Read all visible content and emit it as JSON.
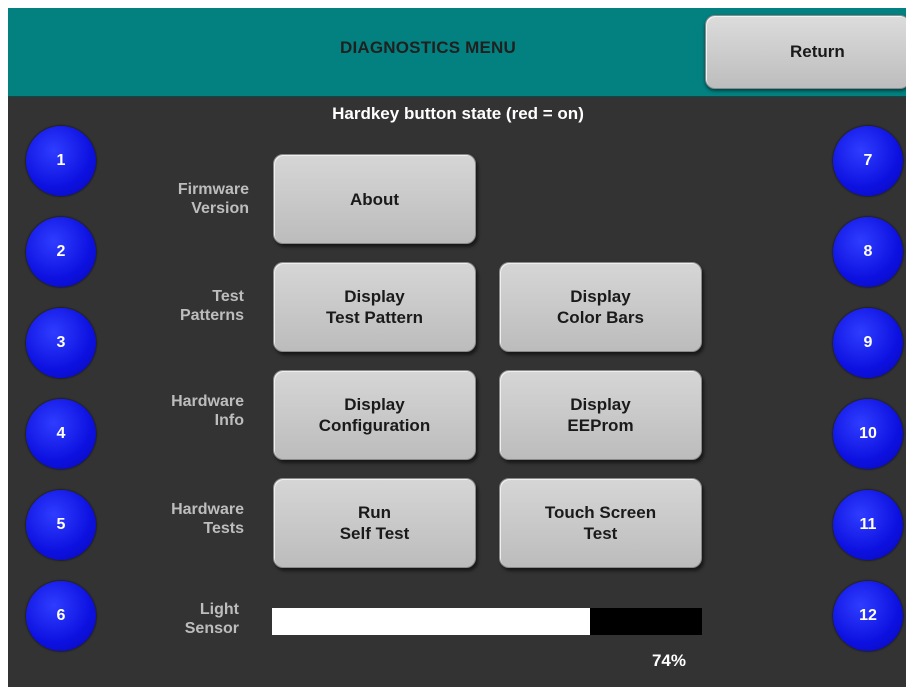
{
  "header": {
    "title": "DIAGNOSTICS MENU",
    "return_label": "Return"
  },
  "subtitle": "Hardkey button state (red = on)",
  "hardkeys": {
    "left": [
      "1",
      "2",
      "3",
      "4",
      "5",
      "6"
    ],
    "right": [
      "7",
      "8",
      "9",
      "10",
      "11",
      "12"
    ],
    "off_color": "#0D11E0",
    "on_color": "#FF0000"
  },
  "rows": {
    "firmware": {
      "label": "Firmware\nVersion",
      "about": "About"
    },
    "test_patterns": {
      "label": "Test\nPatterns",
      "pattern": "Display\nTest Pattern",
      "color_bars": "Display\nColor Bars"
    },
    "hardware_info": {
      "label": "Hardware\nInfo",
      "configuration": "Display\nConfiguration",
      "eeprom": "Display\nEEProm"
    },
    "hardware_tests": {
      "label": "Hardware\nTests",
      "self_test": "Run\nSelf Test",
      "touch_test": "Touch Screen\nTest"
    },
    "light_sensor": {
      "label": "Light\nSensor",
      "level": 0.74,
      "value_text": "74%"
    }
  },
  "colors": {
    "header_bg": "#038080",
    "screen_bg": "#333333",
    "button_bg": "#C8C8C8"
  }
}
